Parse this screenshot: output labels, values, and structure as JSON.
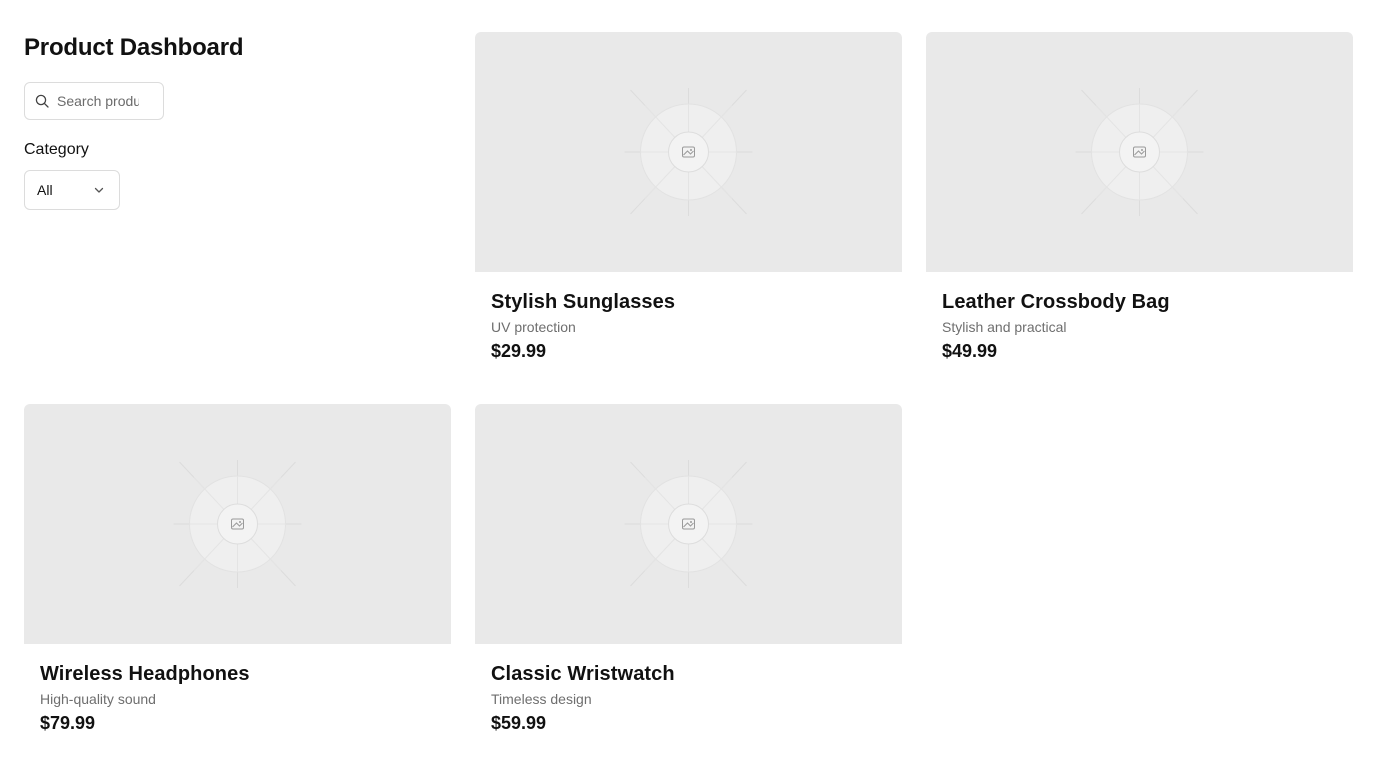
{
  "header": {
    "title": "Product Dashboard"
  },
  "filters": {
    "search_placeholder": "Search products...",
    "category_label": "Category",
    "category_selected": "All"
  },
  "products": [
    {
      "name": "Stylish Sunglasses",
      "description": "UV protection",
      "price": "$29.99"
    },
    {
      "name": "Leather Crossbody Bag",
      "description": "Stylish and practical",
      "price": "$49.99"
    },
    {
      "name": "Wireless Headphones",
      "description": "High-quality sound",
      "price": "$79.99"
    },
    {
      "name": "Classic Wristwatch",
      "description": "Timeless design",
      "price": "$59.99"
    }
  ],
  "icons": {
    "search": "search-icon",
    "dropdown": "chevron-down-icon",
    "image_placeholder": "image-placeholder-icon"
  },
  "colors": {
    "placeholder_bg": "#e9e9e9",
    "text_primary": "#111111",
    "text_secondary": "#6e6e6e",
    "border": "#dcdcdc"
  }
}
